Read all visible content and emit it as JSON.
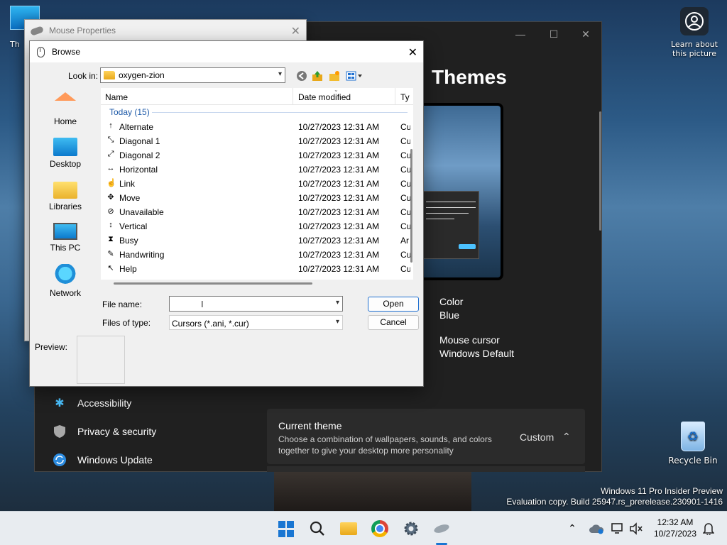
{
  "desktop": {
    "top_icon_label": "Th",
    "spotlight_label": "Learn about this picture",
    "recycle_label": "Recycle Bin",
    "watermark_line1": "Windows 11 Pro Insider Preview",
    "watermark_line2": "Evaluation copy. Build 25947.rs_prerelease.230901-1416"
  },
  "settings": {
    "page_title": "Themes",
    "color_label": "Color",
    "color_value": "Blue",
    "cursor_label": "Mouse cursor",
    "cursor_value": "Windows Default",
    "nav": [
      {
        "label": "Accessibility"
      },
      {
        "label": "Privacy & security"
      },
      {
        "label": "Windows Update"
      }
    ],
    "current_theme_title": "Current theme",
    "current_theme_desc": "Choose a combination of wallpapers, sounds, and colors together to give your desktop more personality",
    "current_theme_value": "Custom",
    "accent_color": "#4cc2ff"
  },
  "mouse_properties": {
    "title": "Mouse Properties"
  },
  "browse": {
    "title": "Browse",
    "look_in_label": "Look in:",
    "look_in_value": "oxygen-zion",
    "places": [
      {
        "label": "Home",
        "icon": "home-icon"
      },
      {
        "label": "Desktop",
        "icon": "desktop-icon"
      },
      {
        "label": "Libraries",
        "icon": "libraries-icon"
      },
      {
        "label": "This PC",
        "icon": "this-pc-icon"
      },
      {
        "label": "Network",
        "icon": "network-icon"
      }
    ],
    "columns": {
      "name": "Name",
      "date": "Date modified",
      "type": "Ty"
    },
    "group": "Today (15)",
    "files": [
      {
        "name": "Alternate",
        "date": "10/27/2023 12:31 AM",
        "type": "Cu",
        "glyph": "↑"
      },
      {
        "name": "Diagonal 1",
        "date": "10/27/2023 12:31 AM",
        "type": "Cu",
        "glyph": "⤡"
      },
      {
        "name": "Diagonal 2",
        "date": "10/27/2023 12:31 AM",
        "type": "Cu",
        "glyph": "⤢"
      },
      {
        "name": "Horizontal",
        "date": "10/27/2023 12:31 AM",
        "type": "Cu",
        "glyph": "↔"
      },
      {
        "name": "Link",
        "date": "10/27/2023 12:31 AM",
        "type": "Cu",
        "glyph": "☝"
      },
      {
        "name": "Move",
        "date": "10/27/2023 12:31 AM",
        "type": "Cu",
        "glyph": "✥"
      },
      {
        "name": "Unavailable",
        "date": "10/27/2023 12:31 AM",
        "type": "Cu",
        "glyph": "⊘"
      },
      {
        "name": "Vertical",
        "date": "10/27/2023 12:31 AM",
        "type": "Cu",
        "glyph": "↕"
      },
      {
        "name": "Busy",
        "date": "10/27/2023 12:31 AM",
        "type": "Ar",
        "glyph": "⧗"
      },
      {
        "name": "Handwriting",
        "date": "10/27/2023 12:31 AM",
        "type": "Cu",
        "glyph": "✎"
      },
      {
        "name": "Help",
        "date": "10/27/2023 12:31 AM",
        "type": "Cu",
        "glyph": "↖"
      }
    ],
    "file_name_label": "File name:",
    "file_name_value": "",
    "files_of_type_label": "Files of type:",
    "files_of_type_value": "Cursors (*.ani, *.cur)",
    "open_label": "Open",
    "cancel_label": "Cancel",
    "preview_label": "Preview:"
  },
  "taskbar": {
    "time": "12:32 AM",
    "date": "10/27/2023",
    "accent": "#1976d2"
  }
}
